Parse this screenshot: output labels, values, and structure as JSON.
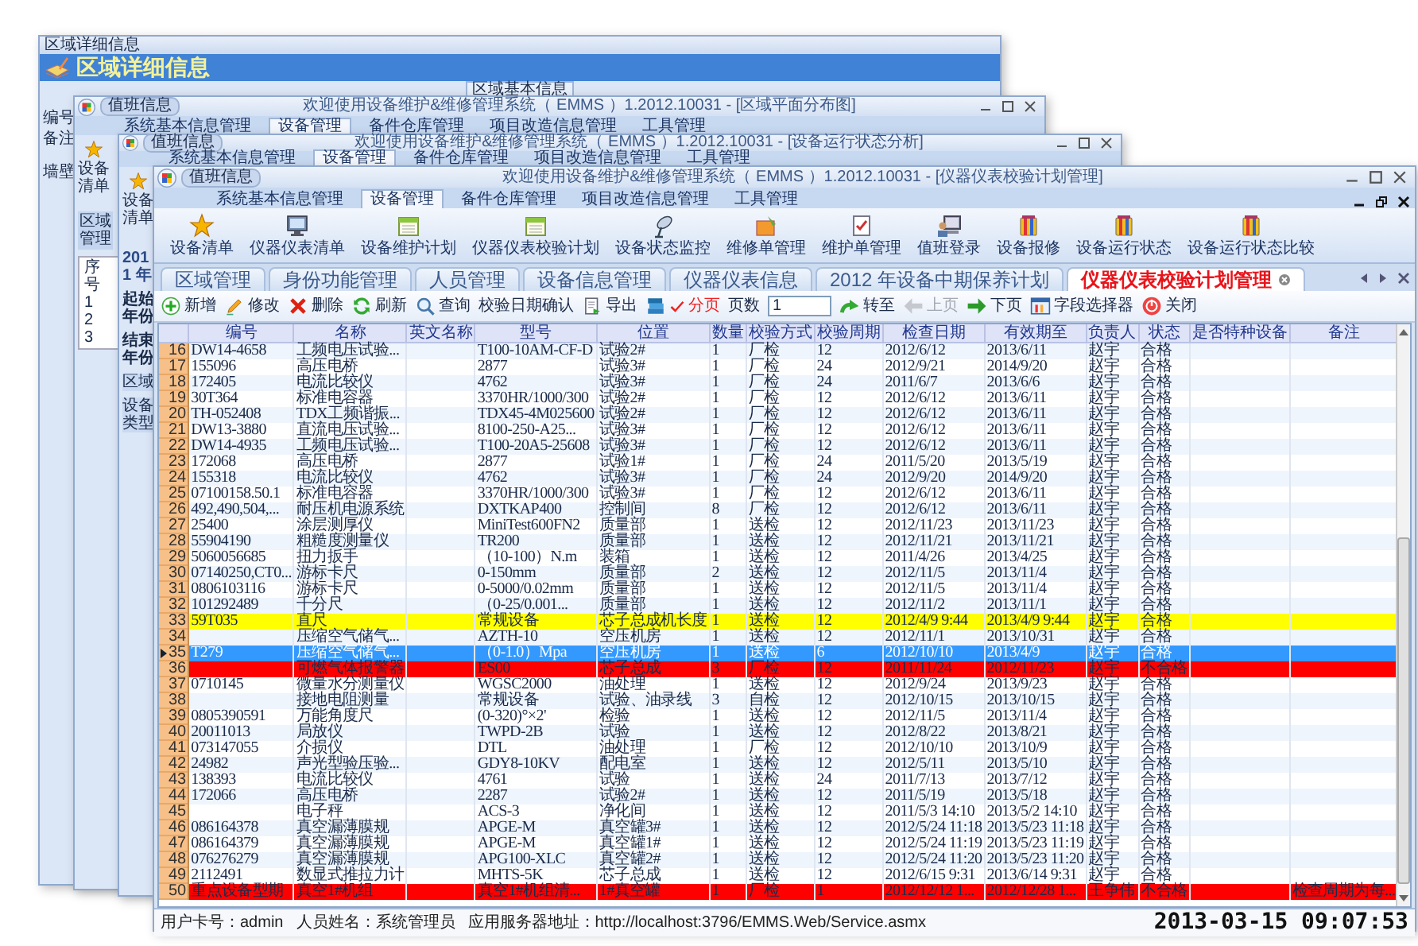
{
  "region_window": {
    "title": "区域详细信息",
    "heading": "区域详细信息",
    "group_title": "区域基本信息",
    "field_labels": [
      "编号",
      "备注"
    ],
    "row_label": "墙壁"
  },
  "floor_plan_window": {
    "quick_button": "值班信息",
    "title": "欢迎使用设备维护&维修管理系统（ EMMS ）1.2012.10031 - [区域平面分布图]",
    "ribbon_tabs": [
      {
        "label": "系统基本信息管理",
        "selected": false
      },
      {
        "label": "设备管理",
        "selected": true
      },
      {
        "label": "备件仓库管理",
        "selected": false
      },
      {
        "label": "项目改造信息管理",
        "selected": false
      },
      {
        "label": "工具管理",
        "selected": false
      }
    ],
    "ribbon_button": "设备清单",
    "panel_title": "区域管理",
    "list_header": "序号",
    "list_rows": [
      "1",
      "2",
      "3"
    ]
  },
  "status_window": {
    "quick_button": "值班信息",
    "title": "欢迎使用设备维护&维修管理系统（ EMMS ）1.2012.10031 - [设备运行状态分析]",
    "ribbon_tabs": [
      {
        "label": "系统基本信息管理",
        "selected": false
      },
      {
        "label": "设备管理",
        "selected": true
      },
      {
        "label": "备件仓库管理",
        "selected": false
      },
      {
        "label": "项目改造信息管理",
        "selected": false
      },
      {
        "label": "工具管理",
        "selected": false
      }
    ],
    "ribbon_button": "设备清单",
    "year": "2011 年",
    "field_labels": [
      "起始年份",
      "结束年份"
    ],
    "tree_items": [
      "区域",
      "设备类型"
    ]
  },
  "main_window": {
    "quick_button": "值班信息",
    "title": "欢迎使用设备维护&维修管理系统（ EMMS ）1.2012.10031 - [仪器仪表校验计划管理]",
    "ribbon_tabs": [
      {
        "label": "系统基本信息管理",
        "selected": false
      },
      {
        "label": "设备管理",
        "selected": true
      },
      {
        "label": "备件仓库管理",
        "selected": false
      },
      {
        "label": "项目改造信息管理",
        "selected": false
      },
      {
        "label": "工具管理",
        "selected": false
      }
    ],
    "ribbon_buttons": [
      "设备清单",
      "仪器仪表清单",
      "设备维护计划",
      "仪器仪表校验计划",
      "设备状态监控",
      "维修单管理",
      "维护单管理",
      "值班登录",
      "设备报修",
      "设备运行状态",
      "设备运行状态比较"
    ],
    "doc_tabs": [
      {
        "label": "区域管理",
        "selected": false
      },
      {
        "label": "身份功能管理",
        "selected": false
      },
      {
        "label": "人员管理",
        "selected": false
      },
      {
        "label": "设备信息管理",
        "selected": false
      },
      {
        "label": "仪器仪表信息",
        "selected": false
      },
      {
        "label": "2012 年设备中期保养计划",
        "selected": false
      },
      {
        "label": "仪器仪表校验计划管理",
        "selected": true
      }
    ],
    "toolbar": [
      {
        "kind": "button",
        "label": "新增",
        "disabled": false
      },
      {
        "kind": "button",
        "label": "修改",
        "disabled": false
      },
      {
        "kind": "button",
        "label": "删除",
        "disabled": false
      },
      {
        "kind": "button",
        "label": "刷新",
        "disabled": false
      },
      {
        "kind": "button",
        "label": "查询",
        "disabled": false
      },
      {
        "kind": "button",
        "label": "校验日期确认",
        "disabled": false
      },
      {
        "kind": "button",
        "label": "导出",
        "disabled": false
      },
      {
        "kind": "toggle",
        "label": "分页",
        "checked": true
      },
      {
        "kind": "field",
        "label": "页数",
        "value": "1"
      },
      {
        "kind": "button",
        "label": "转至",
        "disabled": false
      },
      {
        "kind": "button",
        "label": "上页",
        "disabled": true
      },
      {
        "kind": "button",
        "label": "下页",
        "disabled": false
      },
      {
        "kind": "button",
        "label": "字段选择器",
        "disabled": false
      },
      {
        "kind": "button",
        "label": "关闭",
        "disabled": false
      }
    ],
    "table": {
      "columns": [
        "编号",
        "名称",
        "英文名称",
        "型号",
        "位置",
        "数量",
        "校验方式",
        "校验周期",
        "检查日期",
        "有效期至",
        "负责人",
        "状态",
        "是否特种设备",
        "备注"
      ],
      "rows": [
        {
          "number": "16",
          "selected": false,
          "cells": [
            "DW14-4658",
            "工频电压试验...",
            null,
            "T100-10AM-CF-D",
            "试验2#",
            "1",
            "厂检",
            "12",
            "2012/6/12",
            "2013/6/11",
            "赵宇",
            "合格",
            null,
            null
          ]
        },
        {
          "number": "17",
          "selected": false,
          "cells": [
            "155096",
            "高压电桥",
            null,
            "2877",
            "试验3#",
            "1",
            "厂检",
            "24",
            "2012/9/21",
            "2014/9/20",
            "赵宇",
            "合格",
            null,
            null
          ]
        },
        {
          "number": "18",
          "selected": false,
          "cells": [
            "172405",
            "电流比较仪",
            null,
            "4762",
            "试验3#",
            "1",
            "厂检",
            "24",
            "2011/6/7",
            "2013/6/6",
            "赵宇",
            "合格",
            null,
            null
          ]
        },
        {
          "number": "19",
          "selected": false,
          "cells": [
            "30T364",
            "标准电容器",
            null,
            "3370HR/1000/300",
            "试验2#",
            "1",
            "厂检",
            "12",
            "2012/6/12",
            "2013/6/11",
            "赵宇",
            "合格",
            null,
            null
          ]
        },
        {
          "number": "20",
          "selected": false,
          "cells": [
            "TH-052408",
            "TDX工频谐振...",
            null,
            "TDX45-4M025600",
            "试验2#",
            "1",
            "厂检",
            "12",
            "2012/6/12",
            "2013/6/11",
            "赵宇",
            "合格",
            null,
            null
          ]
        },
        {
          "number": "21",
          "selected": false,
          "cells": [
            "DW13-3880",
            "直流电压试验...",
            null,
            "8100-250-A25...",
            "试验3#",
            "1",
            "厂检",
            "12",
            "2012/6/12",
            "2013/6/11",
            "赵宇",
            "合格",
            null,
            null
          ]
        },
        {
          "number": "22",
          "selected": false,
          "cells": [
            "DW14-4935",
            "工频电压试验...",
            null,
            "T100-20A5-25608",
            "试验3#",
            "1",
            "厂检",
            "12",
            "2012/6/12",
            "2013/6/11",
            "赵宇",
            "合格",
            null,
            null
          ]
        },
        {
          "number": "23",
          "selected": false,
          "cells": [
            "172068",
            "高压电桥",
            null,
            "2877",
            "试验1#",
            "1",
            "厂检",
            "24",
            "2011/5/20",
            "2013/5/19",
            "赵宇",
            "合格",
            null,
            null
          ]
        },
        {
          "number": "24",
          "selected": false,
          "cells": [
            "155318",
            "电流比较仪",
            null,
            "4762",
            "试验3#",
            "1",
            "厂检",
            "24",
            "2012/9/20",
            "2014/9/20",
            "赵宇",
            "合格",
            null,
            null
          ]
        },
        {
          "number": "25",
          "selected": false,
          "cells": [
            "07100158.50.1",
            "标准电容器",
            null,
            "3370HR/1000/300",
            "试验3#",
            "1",
            "厂检",
            "12",
            "2012/6/12",
            "2013/6/11",
            "赵宇",
            "合格",
            null,
            null
          ]
        },
        {
          "number": "26",
          "selected": false,
          "cells": [
            "492,490,504,...",
            "耐压机电源系统",
            null,
            "DXTKAP400",
            "控制间",
            "8",
            "厂检",
            "12",
            "2012/6/12",
            "2013/6/11",
            "赵宇",
            "合格",
            null,
            null
          ]
        },
        {
          "number": "27",
          "selected": false,
          "cells": [
            "25400",
            "涂层测厚仪",
            null,
            "MiniTest600FN2",
            "质量部",
            "1",
            "送检",
            "12",
            "2012/11/23",
            "2013/11/23",
            "赵宇",
            "合格",
            null,
            null
          ]
        },
        {
          "number": "28",
          "selected": false,
          "cells": [
            "55904190",
            "粗糙度测量仪",
            null,
            "TR200",
            "质量部",
            "1",
            "送检",
            "12",
            "2012/11/21",
            "2013/11/21",
            "赵宇",
            "合格",
            null,
            null
          ]
        },
        {
          "number": "29",
          "selected": false,
          "cells": [
            "5060056685",
            "扭力扳手",
            null,
            "（10-100）N.m",
            "装箱",
            "1",
            "送检",
            "12",
            "2011/4/26",
            "2013/4/25",
            "赵宇",
            "合格",
            null,
            null
          ]
        },
        {
          "number": "30",
          "selected": false,
          "cells": [
            "07140250,CT0...",
            "游标卡尺",
            null,
            "0-150mm",
            "质量部",
            "2",
            "送检",
            "12",
            "2012/11/5",
            "2013/11/4",
            "赵宇",
            "合格",
            null,
            null
          ]
        },
        {
          "number": "31",
          "selected": false,
          "cells": [
            "0806103116",
            "游标卡尺",
            null,
            "0-5000/0.02mm",
            "质量部",
            "1",
            "送检",
            "12",
            "2012/11/5",
            "2013/11/4",
            "赵宇",
            "合格",
            null,
            null
          ]
        },
        {
          "number": "32",
          "selected": false,
          "cells": [
            "101292489",
            "千分尺",
            null,
            "（0-25/0.001...",
            "质量部",
            "1",
            "送检",
            "12",
            "2012/11/2",
            "2013/11/1",
            "赵宇",
            "合格",
            null,
            null
          ]
        },
        {
          "number": "33",
          "selected": false,
          "color": "#ffff00",
          "cells": [
            "59T035",
            "直尺",
            null,
            "常规设备",
            "芯子总成机长度",
            "1",
            "送检",
            "12",
            "2012/4/9 9:44",
            "2013/4/9 9:44",
            "赵宇",
            "合格",
            null,
            null
          ]
        },
        {
          "number": "34",
          "selected": false,
          "cells": [
            null,
            "压缩空气储气...",
            null,
            "AZTH-10",
            "空压机房",
            "1",
            "送检",
            "12",
            "2012/11/1",
            "2013/10/31",
            "赵宇",
            "合格",
            null,
            null
          ]
        },
        {
          "number": "35",
          "selected": true,
          "cells": [
            "T279",
            "压缩空气储气...",
            null,
            "（0-1.0）Mpa",
            "空压机房",
            "1",
            "送检",
            "6",
            "2012/10/10",
            "2013/4/9",
            "赵宇",
            "合格",
            null,
            null
          ]
        },
        {
          "number": "36",
          "selected": false,
          "color": "#ff0000",
          "cells": [
            null,
            "可燃气体报警器",
            null,
            "ES00",
            "芯子总成",
            "3",
            "厂检",
            "12",
            "2011/11/24",
            "2012/11/23",
            "赵宇",
            "不合格",
            null,
            null
          ]
        },
        {
          "number": "37",
          "selected": false,
          "cells": [
            "0710145",
            "微量水分测量仪",
            null,
            "WGSC2000",
            "油处理",
            "1",
            "送检",
            "12",
            "2012/9/24",
            "2013/9/23",
            "赵宇",
            "合格",
            null,
            null
          ]
        },
        {
          "number": "38",
          "selected": false,
          "cells": [
            null,
            "接地电阻测量",
            null,
            "常规设备",
            "试验、油录线",
            "3",
            "自检",
            "12",
            "2012/10/15",
            "2013/10/15",
            "赵宇",
            "合格",
            null,
            null
          ]
        },
        {
          "number": "39",
          "selected": false,
          "cells": [
            "0805390591",
            "万能角度尺",
            null,
            "(0-320)°×2'",
            "检验",
            "1",
            "送检",
            "12",
            "2012/11/5",
            "2013/11/4",
            "赵宇",
            "合格",
            null,
            null
          ]
        },
        {
          "number": "40",
          "selected": false,
          "cells": [
            "20011013",
            "局放仪",
            null,
            "TWPD-2B",
            "试验",
            "1",
            "送检",
            "12",
            "2012/8/22",
            "2013/8/21",
            "赵宇",
            "合格",
            null,
            null
          ]
        },
        {
          "number": "41",
          "selected": false,
          "cells": [
            "073147055",
            "介损仪",
            null,
            "DTL",
            "油处理",
            "1",
            "厂检",
            "12",
            "2012/10/10",
            "2013/10/9",
            "赵宇",
            "合格",
            null,
            null
          ]
        },
        {
          "number": "42",
          "selected": false,
          "cells": [
            "24982",
            "声光型验压验...",
            null,
            "GDY8-10KV",
            "配电室",
            "1",
            "送检",
            "12",
            "2012/5/11",
            "2013/5/10",
            "赵宇",
            "合格",
            null,
            null
          ]
        },
        {
          "number": "43",
          "selected": false,
          "cells": [
            "138393",
            "电流比较仪",
            null,
            "4761",
            "试验",
            "1",
            "送检",
            "24",
            "2011/7/13",
            "2013/7/12",
            "赵宇",
            "合格",
            null,
            null
          ]
        },
        {
          "number": "44",
          "selected": false,
          "cells": [
            "172066",
            "高压电桥",
            null,
            "2287",
            "试验2#",
            "1",
            "送检",
            "12",
            "2011/5/19",
            "2013/5/18",
            "赵宇",
            "合格",
            null,
            null
          ]
        },
        {
          "number": "45",
          "selected": false,
          "cells": [
            null,
            "电子秤",
            null,
            "ACS-3",
            "净化间",
            "1",
            "送检",
            "12",
            "2011/5/3 14:10",
            "2013/5/2 14:10",
            "赵宇",
            "合格",
            null,
            null
          ]
        },
        {
          "number": "46",
          "selected": false,
          "cells": [
            "086164378",
            "真空漏薄膜规",
            null,
            "APGE-M",
            "真空罐3#",
            "1",
            "送检",
            "12",
            "2012/5/24 11:18",
            "2013/5/23 11:18",
            "赵宇",
            "合格",
            null,
            null
          ]
        },
        {
          "number": "47",
          "selected": false,
          "cells": [
            "086164379",
            "真空漏薄膜规",
            null,
            "APGE-M",
            "真空罐1#",
            "1",
            "送检",
            "12",
            "2012/5/24 11:19",
            "2013/5/23 11:19",
            "赵宇",
            "合格",
            null,
            null
          ]
        },
        {
          "number": "48",
          "selected": false,
          "cells": [
            "076276279",
            "真空漏薄膜规",
            null,
            "APG100-XLC",
            "真空罐2#",
            "1",
            "送检",
            "12",
            "2012/5/24 11:20",
            "2013/5/23 11:20",
            "赵宇",
            "合格",
            null,
            null
          ]
        },
        {
          "number": "49",
          "selected": false,
          "cells": [
            "2112491",
            "数显式推拉力计",
            null,
            "MHTS-5K",
            "芯子总成",
            "1",
            "送检",
            "12",
            "2012/6/15 9:31",
            "2013/6/14 9:31",
            "赵宇",
            "合格",
            null,
            null
          ]
        },
        {
          "number": "50",
          "selected": false,
          "color": "#ff0000",
          "cells": [
            "重点设备型期",
            "真空1#机组",
            null,
            "真空1#机组清...",
            "1#真空罐",
            "1",
            "厂检",
            "1",
            "2012/12/12 1...",
            "2012/12/28 1...",
            "王争伟",
            "不合格",
            null,
            "检查周期为每..."
          ]
        }
      ]
    },
    "status_bar": {
      "items": [
        "用户卡号：admin",
        "人员姓名：系统管理员",
        "应用服务器地址：http://localhost:3796/EMMS.Web/Service.asmx"
      ],
      "datetime": "2013-03-15 09:07:53"
    }
  }
}
